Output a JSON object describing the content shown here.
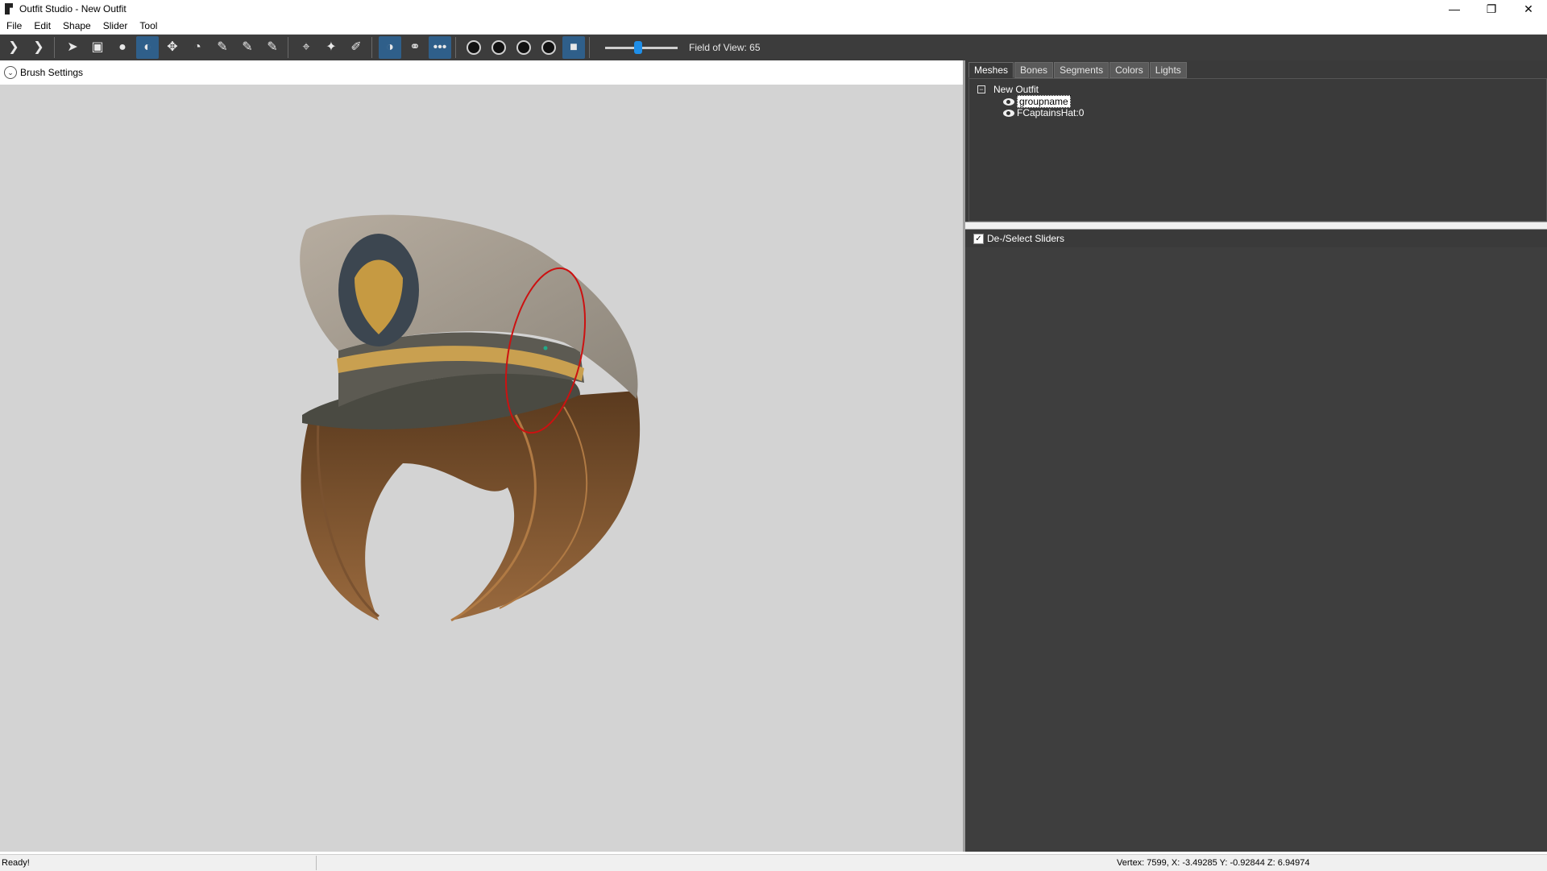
{
  "window": {
    "title": "Outfit Studio - New Outfit",
    "controls": {
      "minimize": "—",
      "restore": "❐",
      "close": "✕"
    }
  },
  "menu": [
    "File",
    "Edit",
    "Shape",
    "Slider",
    "Tool"
  ],
  "toolbar": {
    "field_of_view_label": "Field of View: 65",
    "fov_slider_value": 0.45
  },
  "brush_settings": {
    "label": "Brush Settings"
  },
  "right_panel": {
    "tabs": [
      "Meshes",
      "Bones",
      "Segments",
      "Colors",
      "Lights"
    ],
    "active_tab": "Meshes",
    "tree": {
      "root": "New Outfit",
      "children": [
        "groupname",
        "FCaptainsHat:0"
      ]
    },
    "sliders_header": "De-/Select Sliders"
  },
  "status": {
    "left": "Ready!",
    "right": "Vertex: 7599, X: -3.49285 Y: -0.92844 Z: 6.94974"
  },
  "colors": {
    "toolbar_bg": "#3c3c3c",
    "viewport_bg": "#d3d3d3",
    "panel_bg": "#3a3a3a",
    "accent": "#1e8ee8",
    "brush_circle": "#cc1111"
  }
}
